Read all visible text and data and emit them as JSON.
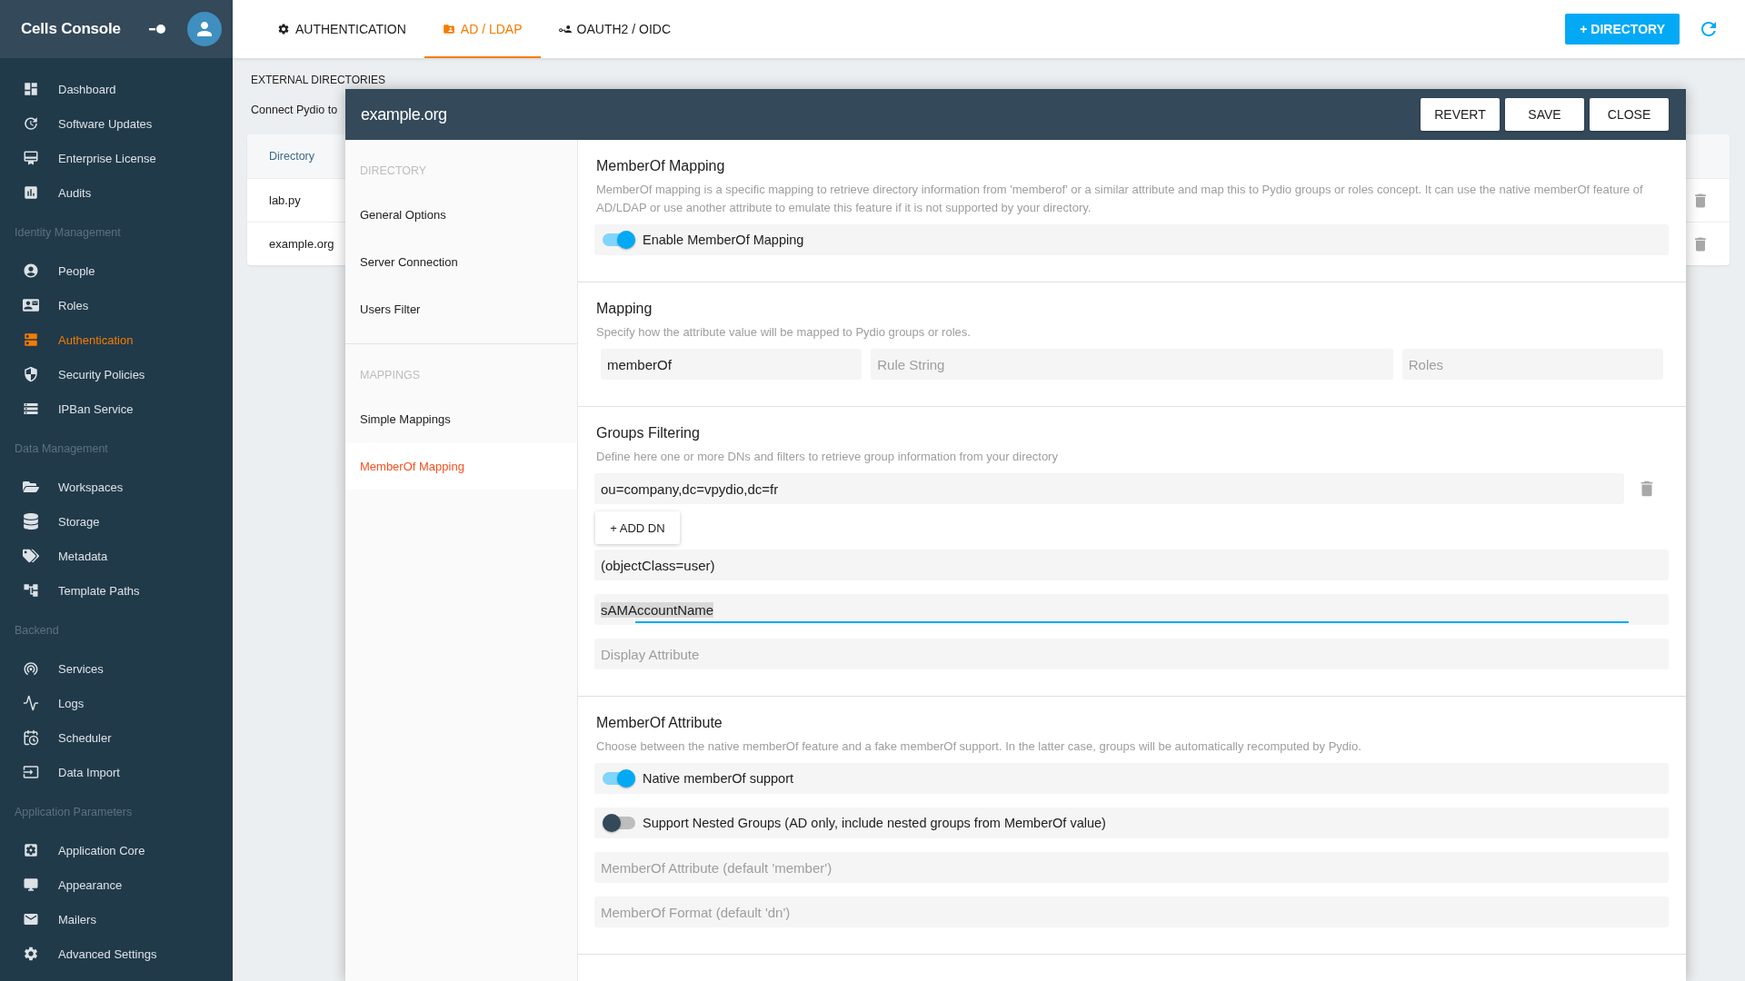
{
  "sidebar": {
    "title": "Cells Console",
    "sections": [
      {
        "items": [
          {
            "label": "Dashboard",
            "selected": false
          },
          {
            "label": "Software Updates",
            "selected": false
          },
          {
            "label": "Enterprise License",
            "selected": false
          },
          {
            "label": "Audits",
            "selected": false
          }
        ]
      },
      {
        "heading": "Identity Management",
        "items": [
          {
            "label": "People",
            "selected": false
          },
          {
            "label": "Roles",
            "selected": false
          },
          {
            "label": "Authentication",
            "selected": true
          },
          {
            "label": "Security Policies",
            "selected": false
          },
          {
            "label": "IPBan Service",
            "selected": false
          }
        ]
      },
      {
        "heading": "Data Management",
        "items": [
          {
            "label": "Workspaces",
            "selected": false
          },
          {
            "label": "Storage",
            "selected": false
          },
          {
            "label": "Metadata",
            "selected": false
          },
          {
            "label": "Template Paths",
            "selected": false
          }
        ]
      },
      {
        "heading": "Backend",
        "items": [
          {
            "label": "Services",
            "selected": false
          },
          {
            "label": "Logs",
            "selected": false
          },
          {
            "label": "Scheduler",
            "selected": false
          },
          {
            "label": "Data Import",
            "selected": false
          }
        ]
      },
      {
        "heading": "Application Parameters",
        "items": [
          {
            "label": "Application Core",
            "selected": false
          },
          {
            "label": "Appearance",
            "selected": false
          },
          {
            "label": "Mailers",
            "selected": false
          },
          {
            "label": "Advanced Settings",
            "selected": false
          }
        ]
      }
    ]
  },
  "top_bar": {
    "tabs": [
      {
        "label": "AUTHENTICATION",
        "selected": false
      },
      {
        "label": "AD / LDAP",
        "selected": true
      },
      {
        "label": "OAUTH2 / OIDC",
        "selected": false
      }
    ],
    "add_button": "+ DIRECTORY"
  },
  "page": {
    "heading": "EXTERNAL DIRECTORIES",
    "intro": "Connect Pydio to",
    "table": {
      "columns": [
        "Directory"
      ],
      "rows": [
        {
          "directory": "lab.py"
        },
        {
          "directory": "example.org"
        }
      ]
    }
  },
  "dialog": {
    "title": "example.org",
    "buttons": [
      "REVERT",
      "SAVE",
      "CLOSE"
    ],
    "nav": [
      {
        "heading": "DIRECTORY",
        "items": [
          {
            "label": "General Options",
            "selected": false
          },
          {
            "label": "Server Connection",
            "selected": false
          },
          {
            "label": "Users Filter",
            "selected": false
          }
        ]
      },
      {
        "heading": "MAPPINGS",
        "items": [
          {
            "label": "Simple Mappings",
            "selected": false
          },
          {
            "label": "MemberOf Mapping",
            "selected": true
          }
        ]
      }
    ],
    "sections": [
      {
        "title": "MemberOf Mapping",
        "description": "MemberOf mapping is a specific mapping to retrieve directory information from 'memberof' or a similar attribute and map this to Pydio groups or roles concept. It can use the native memberOf feature of AD/LDAP or use another attribute to emulate this feature if it is not supported by your directory.",
        "fields": [
          {
            "kind": "toggle",
            "label": "Enable MemberOf Mapping",
            "on": true
          }
        ]
      },
      {
        "title": "Mapping",
        "description": "Specify how the attribute value will be mapped to Pydio groups or roles.",
        "fields": [
          {
            "kind": "text_row",
            "items": [
              {
                "value": "memberOf",
                "focused": false
              },
              {
                "placeholder": "Rule String",
                "focused": false
              },
              {
                "placeholder": "Roles",
                "focused": false
              }
            ]
          }
        ]
      },
      {
        "title": "Groups Filtering",
        "description": "Define here one or more DNs and filters to retrieve group information from your directory",
        "fields": [
          {
            "kind": "removable_text",
            "value": "ou=company,dc=vpydio,dc=fr",
            "focused": false
          },
          {
            "kind": "add_button",
            "label": "+ ADD DN"
          },
          {
            "kind": "text",
            "value": "(objectClass=user)",
            "focused": false
          },
          {
            "kind": "text",
            "value": "sAMAccountName",
            "focused": true
          },
          {
            "kind": "text",
            "placeholder": "Display Attribute",
            "focused": false
          }
        ]
      },
      {
        "title": "MemberOf Attribute",
        "description": "Choose between the native memberOf feature and a fake memberOf support. In the latter case, groups will be automatically recomputed by Pydio.",
        "fields": [
          {
            "kind": "toggle",
            "label": "Native memberOf support",
            "on": true
          },
          {
            "kind": "toggle",
            "label": "Support Nested Groups (AD only, include nested groups from MemberOf value)",
            "on": false
          },
          {
            "kind": "text",
            "placeholder": "MemberOf Attribute (default 'member')",
            "focused": false
          },
          {
            "kind": "text",
            "placeholder": "MemberOf Format (default 'dn')",
            "focused": false
          }
        ]
      }
    ]
  }
}
